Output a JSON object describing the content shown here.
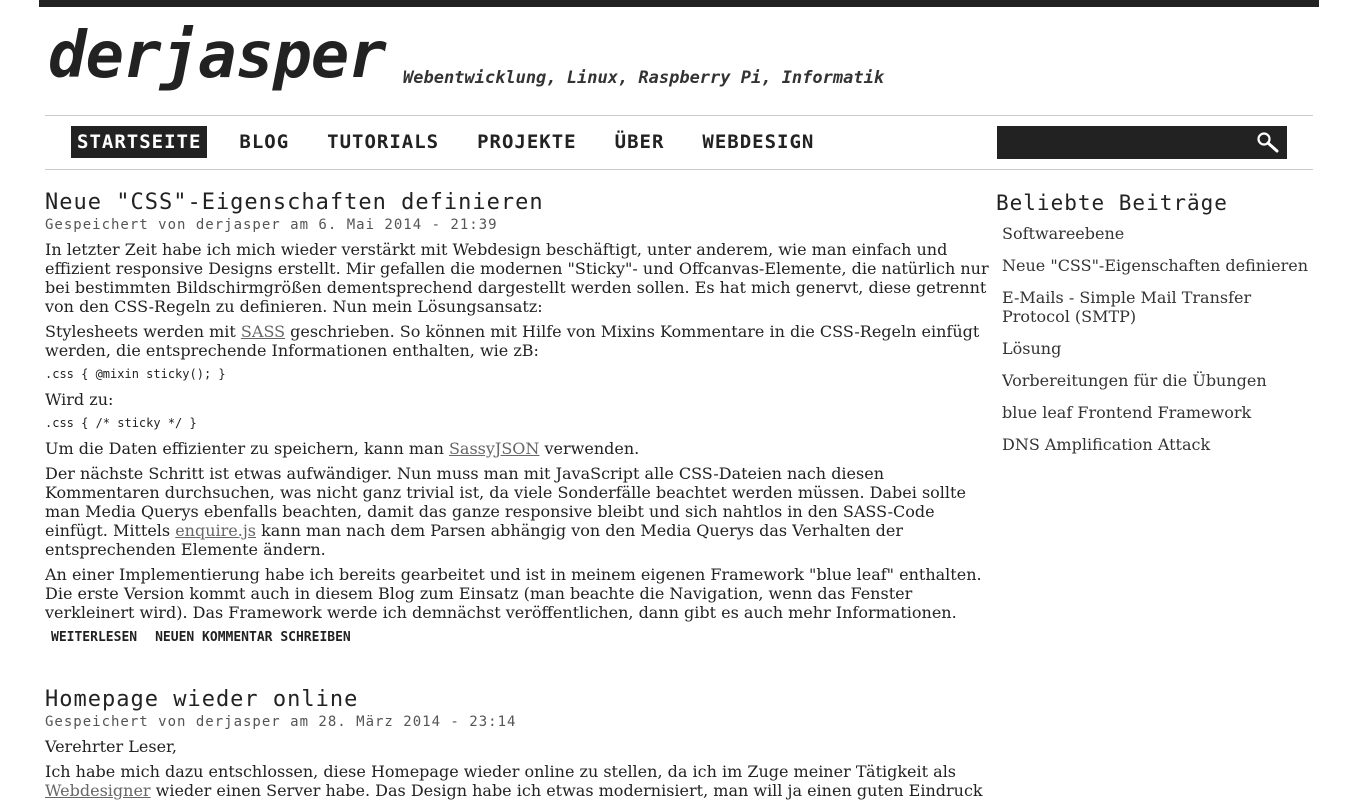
{
  "site": {
    "logo": "derjasper",
    "tagline": "Webentwicklung, Linux, Raspberry Pi, Informatik"
  },
  "nav": {
    "items": [
      "Startseite",
      "Blog",
      "Tutorials",
      "Projekte",
      "Über",
      "Webdesign"
    ]
  },
  "search": {
    "placeholder": "",
    "icon": "search-icon"
  },
  "articles": [
    {
      "title": "Neue \"CSS\"-Eigenschaften definieren",
      "meta": "Gespeichert von derjasper am 6. Mai 2014 - 21:39",
      "p1": "In letzter Zeit habe ich mich wieder verstärkt mit Webdesign beschäftigt, unter anderem, wie man einfach und effizient responsive Designs erstellt. Mir gefallen die modernen \"Sticky\"- und Offcanvas-Elemente, die natürlich nur bei bestimmten Bildschirmgrößen dementsprechend dargestellt werden sollen. Es hat mich genervt, diese getrennt von den CSS-Regeln zu definieren. Nun mein Lösungsansatz:",
      "p2_before": "Stylesheets werden mit ",
      "p2_link": "SASS",
      "p2_after": " geschrieben. So können mit Hilfe von Mixins Kommentare in die CSS-Regeln einfügt werden, die entsprechende Informationen enthalten, wie zB:",
      "code1": ".css { @mixin sticky(); }",
      "p3": "Wird zu:",
      "code2": ".css { /* sticky */ }",
      "p4_before": "Um die Daten effizienter zu speichern, kann man ",
      "p4_link": "SassyJSON",
      "p4_after": " verwenden.",
      "p5_before": "Der nächste Schritt ist etwas aufwändiger. Nun muss man mit JavaScript alle CSS-Dateien nach diesen Kommentaren durchsuchen, was nicht ganz trivial ist, da viele Sonderfälle beachtet werden müssen. Dabei sollte man Media Querys ebenfalls beachten, damit das ganze responsive bleibt und sich nahtlos in den SASS-Code einfügt. Mittels ",
      "p5_link": "enquire.js",
      "p5_after": " kann man nach dem Parsen abhängig von den Media Querys das Verhalten der entsprechenden Elemente ändern.",
      "p6": "An einer Implementierung habe ich bereits gearbeitet und ist in meinem eigenen Framework \"blue leaf\" enthalten. Die erste Version kommt auch in diesem Blog zum Einsatz (man beachte die Navigation, wenn das Fenster verkleinert wird). Das Framework werde ich demnächst veröffentlichen, dann gibt es auch mehr Informationen.",
      "read_more": "Weiterlesen",
      "comment": "Neuen Kommentar schreiben"
    },
    {
      "title": "Homepage wieder online",
      "meta": "Gespeichert von derjasper am 28. März 2014 - 23:14",
      "p1": "Verehrter Leser,",
      "p2_before": "Ich habe mich dazu entschlossen, diese Homepage wieder online zu stellen, da ich im Zuge meiner Tätigkeit als ",
      "p2_link": "Webdesigner",
      "p2_after": " wieder einen Server habe. Das Design habe ich etwas modernisiert, man will ja einen guten Eindruck"
    }
  ],
  "sidebar": {
    "title": "Beliebte Beiträge",
    "items": [
      "Softwareebene",
      "Neue \"CSS\"-Eigenschaften definieren",
      "E-Mails - Simple Mail Transfer Protocol (SMTP)",
      "Lösung",
      "Vorbereitungen für die Übungen",
      "blue leaf Frontend Framework",
      "DNS Amplification Attack"
    ]
  }
}
